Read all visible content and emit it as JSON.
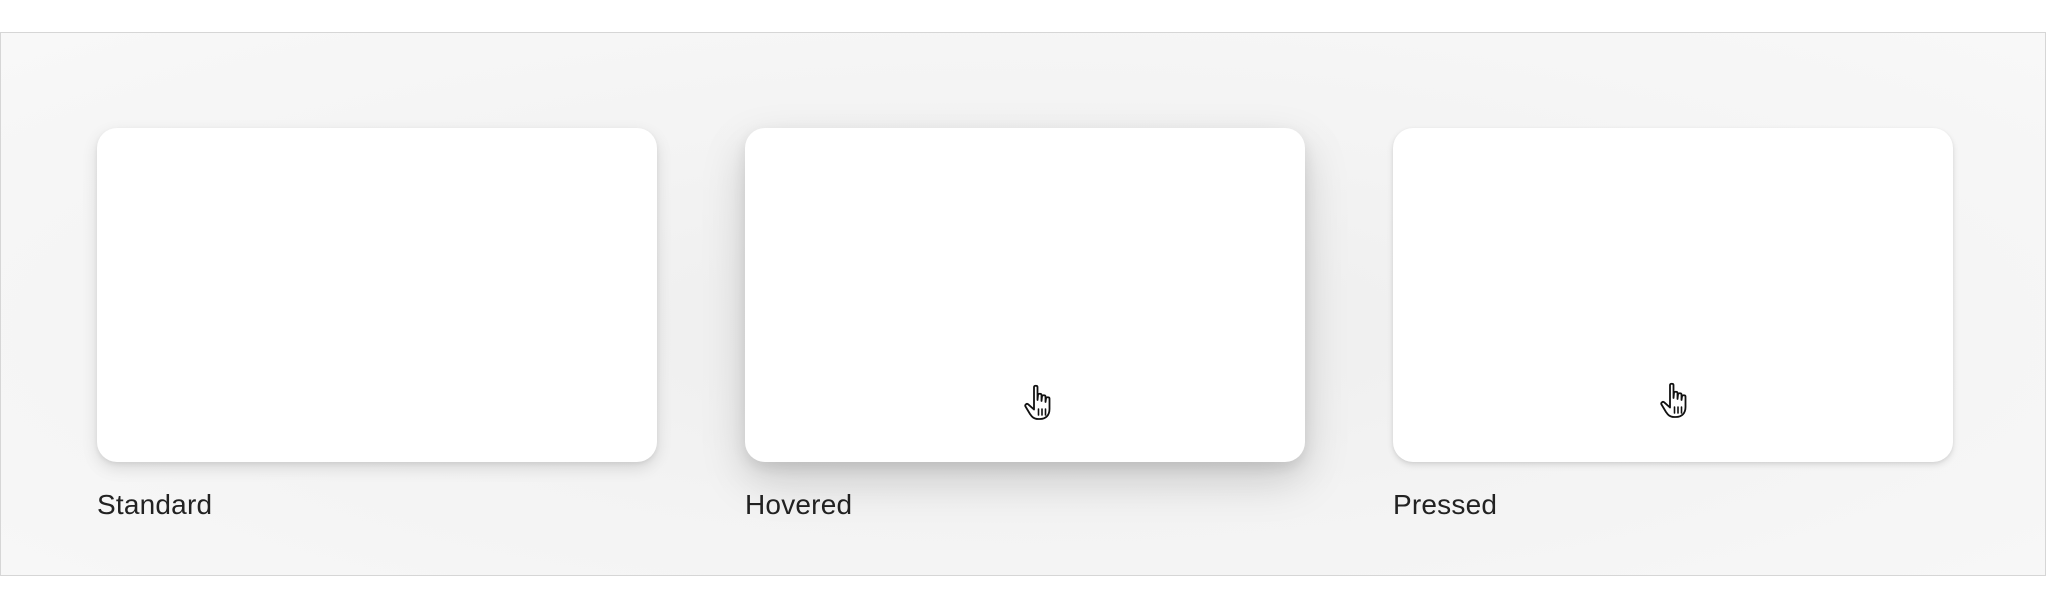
{
  "states": [
    {
      "label": "Standard",
      "cursor": "none"
    },
    {
      "label": "Hovered",
      "cursor": "hand-pointer-icon"
    },
    {
      "label": "Pressed",
      "cursor": "hand-pointer-icon"
    }
  ],
  "colors": {
    "background": "#f6f6f6",
    "card": "#ffffff",
    "border": "#d6d6d6",
    "label_text": "#222222"
  }
}
